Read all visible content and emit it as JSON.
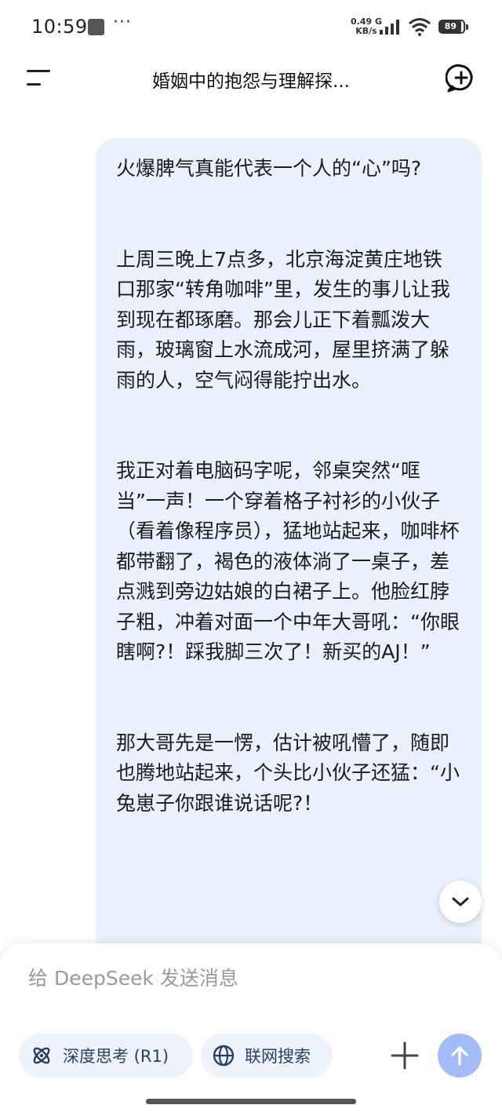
{
  "status_bar": {
    "time": "10:59",
    "more_dots": "···",
    "net_speed_value": "0.49 G",
    "net_speed_unit": "KB/s",
    "battery": "89"
  },
  "header": {
    "title": "婚姻中的抱怨与理解探...",
    "menu_icon": "menu-icon",
    "new_chat_icon": "new-chat-icon"
  },
  "message": {
    "paragraphs": [
      "火爆脾气真能代表一个人的“心”吗?",
      "上周三晚上7点多，北京海淀黄庄地铁口那家“转角咖啡”里，发生的事儿让我到现在都琢磨。那会儿正下着瓢泼大雨，玻璃窗上水流成河，屋里挤满了躲雨的人，空气闷得能拧出水。",
      "我正对着电脑码字呢，邻桌突然“哐当”一声！一个穿着格子衬衫的小伙子（看着像程序员），猛地站起来，咖啡杯都带翻了，褐色的液体淌了一桌子，差点溅到旁边姑娘的白裙子上。他脸红脖子粗，冲着对面一个中年大哥吼：“你眼瞎啊?！踩我脚三次了！新买的AJ！”",
      "那大哥先是一愣，估计被吼懵了，随即也腾地站起来，个头比小伙子还猛：“小兔崽子你跟谁说话呢?！"
    ]
  },
  "composer": {
    "placeholder": "给 DeepSeek 发送消息",
    "deep_think_label": "深度思考 (R1)",
    "web_search_label": "联网搜索"
  },
  "colors": {
    "bubble_bg": "#eaf0fc",
    "pill_bg": "#eef2fb",
    "accent": "#4d6bfe",
    "send_disabled": "#a3bcf7"
  }
}
